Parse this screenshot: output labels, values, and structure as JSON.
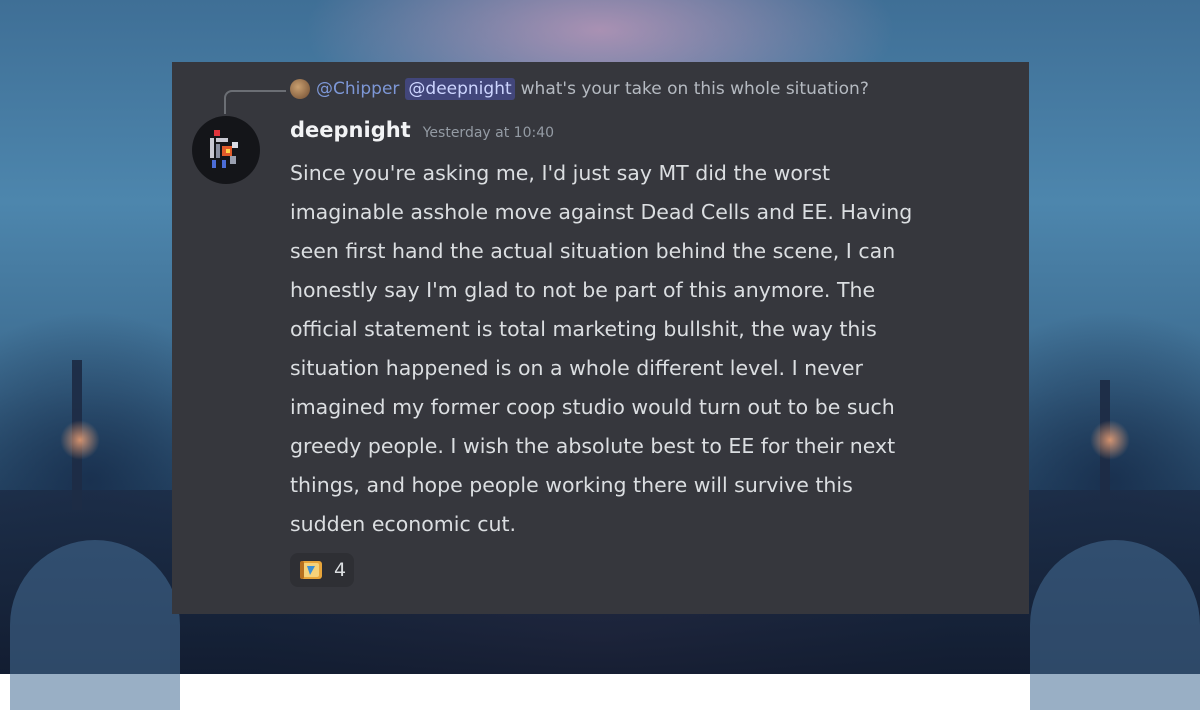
{
  "reply": {
    "author": "@Chipper",
    "mention": "@deepnight",
    "text": "what's your take on this whole situation?"
  },
  "message": {
    "username": "deepnight",
    "timestamp": "Yesterday at 10:40",
    "lines": [
      "Since you're asking me, I'd just say MT did the worst",
      "imaginable asshole move against Dead Cells and EE. Having",
      "seen first hand the actual situation behind the scene, I can",
      "honestly say I'm glad to not be part of this anymore. The",
      "official statement is total marketing bullshit, the way this",
      "situation happened is on a whole different level. I never",
      "imagined my former coop studio would turn out to be such",
      "greedy people. I wish the absolute best to EE for their next",
      "things, and hope people working there will survive this",
      "sudden economic cut."
    ]
  },
  "reaction": {
    "icon": "scroll-emoji-icon",
    "count": "4"
  },
  "colors": {
    "panel": "#36373d",
    "mention_bg": "#5865f2",
    "text": "#dbdee1"
  }
}
